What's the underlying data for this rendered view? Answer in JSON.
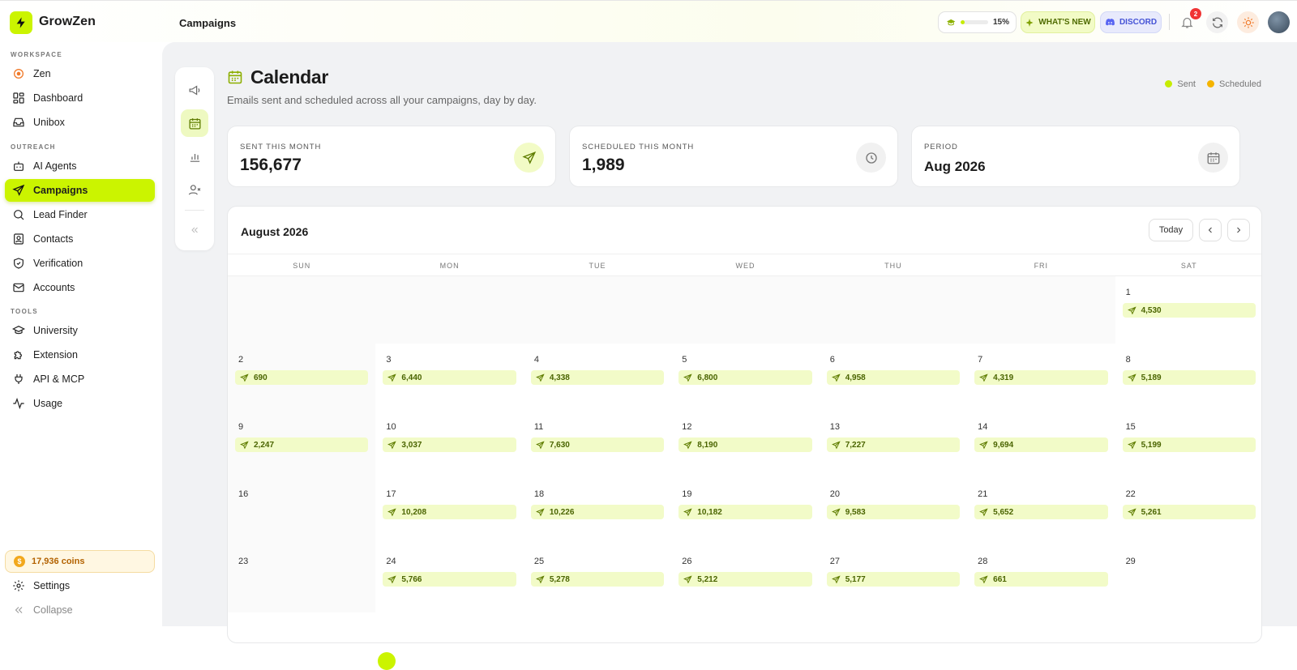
{
  "app": {
    "name": "GrowZen"
  },
  "header": {
    "breadcrumb": "Campaigns",
    "progress_text": "15%",
    "progress_value": 0.15,
    "whats_new": "WHAT'S NEW",
    "discord": "DISCORD",
    "notifications": "2"
  },
  "sidebar": {
    "sections": {
      "workspace": "WORKSPACE",
      "outreach": "OUTREACH",
      "tools": "TOOLS"
    },
    "items": [
      {
        "label": "Zen",
        "icon": "zen-icon"
      },
      {
        "label": "Dashboard",
        "icon": "dashboard-icon"
      },
      {
        "label": "Unibox",
        "icon": "inbox-icon"
      },
      {
        "label": "AI Agents",
        "icon": "bot-icon"
      },
      {
        "label": "Campaigns",
        "icon": "send-icon"
      },
      {
        "label": "Lead Finder",
        "icon": "search-icon"
      },
      {
        "label": "Contacts",
        "icon": "contacts-icon"
      },
      {
        "label": "Verification",
        "icon": "shield-check-icon"
      },
      {
        "label": "Accounts",
        "icon": "mail-icon"
      },
      {
        "label": "University",
        "icon": "graduation-cap-icon"
      },
      {
        "label": "Extension",
        "icon": "puzzle-icon"
      },
      {
        "label": "API & MCP",
        "icon": "plug-icon"
      },
      {
        "label": "Usage",
        "icon": "activity-icon"
      }
    ],
    "coins": "17,936 coins",
    "settings": "Settings",
    "collapse": "Collapse"
  },
  "page": {
    "title": "Calendar",
    "subtitle": "Emails sent and scheduled across all your campaigns, day by day.",
    "legend": {
      "sent": "Sent",
      "scheduled": "Scheduled"
    },
    "colors": {
      "accent": "#cbf400",
      "sent": "#c6ec00",
      "scheduled": "#f5b400"
    }
  },
  "stats": {
    "sent": {
      "label": "SENT THIS MONTH",
      "value": "156,677"
    },
    "scheduled": {
      "label": "SCHEDULED THIS MONTH",
      "value": "1,989"
    },
    "period": {
      "label": "PERIOD",
      "value": "Aug 2026"
    }
  },
  "calendar": {
    "month": "August 2026",
    "today": "Today",
    "weekdays": [
      "SUN",
      "MON",
      "TUE",
      "WED",
      "THU",
      "FRI",
      "SAT"
    ],
    "days": {
      "1": "4,530",
      "2": "690",
      "3": "6,440",
      "4": "4,338",
      "5": "6,800",
      "6": "4,958",
      "7": "4,319",
      "8": "5,189",
      "9": "2,247",
      "10": "3,037",
      "11": "7,630",
      "12": "8,190",
      "13": "7,227",
      "14": "9,694",
      "15": "5,199",
      "16": "",
      "17": "10,208",
      "18": "10,226",
      "19": "10,182",
      "20": "9,583",
      "21": "5,652",
      "22": "5,261",
      "23": "",
      "24": "5,766",
      "25": "5,278",
      "26": "5,212",
      "27": "5,177",
      "28": "661",
      "29": ""
    }
  }
}
